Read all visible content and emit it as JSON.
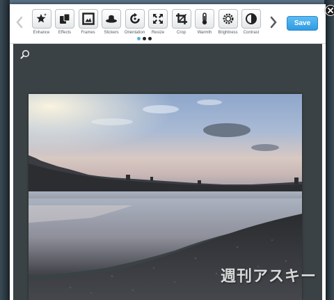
{
  "toolbar": {
    "tools": [
      {
        "label": "Enhance",
        "icon": "enhance-star-icon"
      },
      {
        "label": "Effects",
        "icon": "effects-icon"
      },
      {
        "label": "Frames",
        "icon": "frames-icon"
      },
      {
        "label": "Stickers",
        "icon": "stickers-hat-icon"
      },
      {
        "label": "Orientation",
        "icon": "orientation-rotate-icon"
      },
      {
        "label": "Resize",
        "icon": "resize-arrows-icon"
      },
      {
        "label": "Crop",
        "icon": "crop-icon"
      },
      {
        "label": "Warmth",
        "icon": "thermometer-icon"
      },
      {
        "label": "Brightness",
        "icon": "brightness-sun-icon"
      },
      {
        "label": "Contrast",
        "icon": "contrast-icon"
      }
    ],
    "page_dots": [
      "#5ab0e6",
      "#222222",
      "#222222"
    ],
    "save_label": "Save"
  },
  "watermark": "週刊アスキー",
  "colors": {
    "accent": "#2f9be2",
    "canvas_bg": "#3b4245"
  }
}
